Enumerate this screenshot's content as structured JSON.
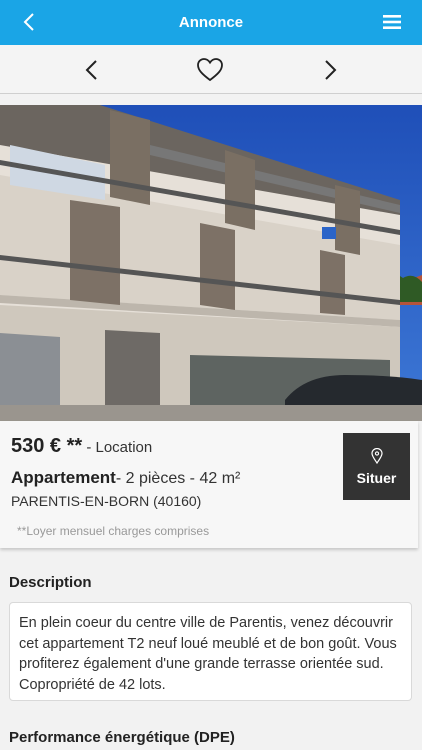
{
  "header": {
    "title": "Annonce",
    "back_icon": "chevron-left-icon",
    "menu_icon": "hamburger-menu-icon",
    "accent_color": "#1aa5e6"
  },
  "nav": {
    "prev_icon": "chevron-left-icon",
    "favorite_icon": "heart-outline-icon",
    "next_icon": "chevron-right-icon"
  },
  "listing": {
    "price": "530 € **",
    "transaction": " - Location",
    "type": "Appartement",
    "details": "- 2 pièces - 42 m²",
    "city": "PARENTIS-EN-BORN (40160)",
    "note": "**Loyer mensuel charges comprises",
    "locate_label": "Situer",
    "locate_icon": "map-pin-icon"
  },
  "description": {
    "title": "Description",
    "text": "En plein coeur du centre ville de Parentis, venez découvrir cet appartement T2 neuf loué meublé et de bon goût. Vous profiterez également d'une grande terrasse orientée sud. Copropriété de 42 lots."
  },
  "energy": {
    "title": "Performance énergétique (DPE)"
  }
}
